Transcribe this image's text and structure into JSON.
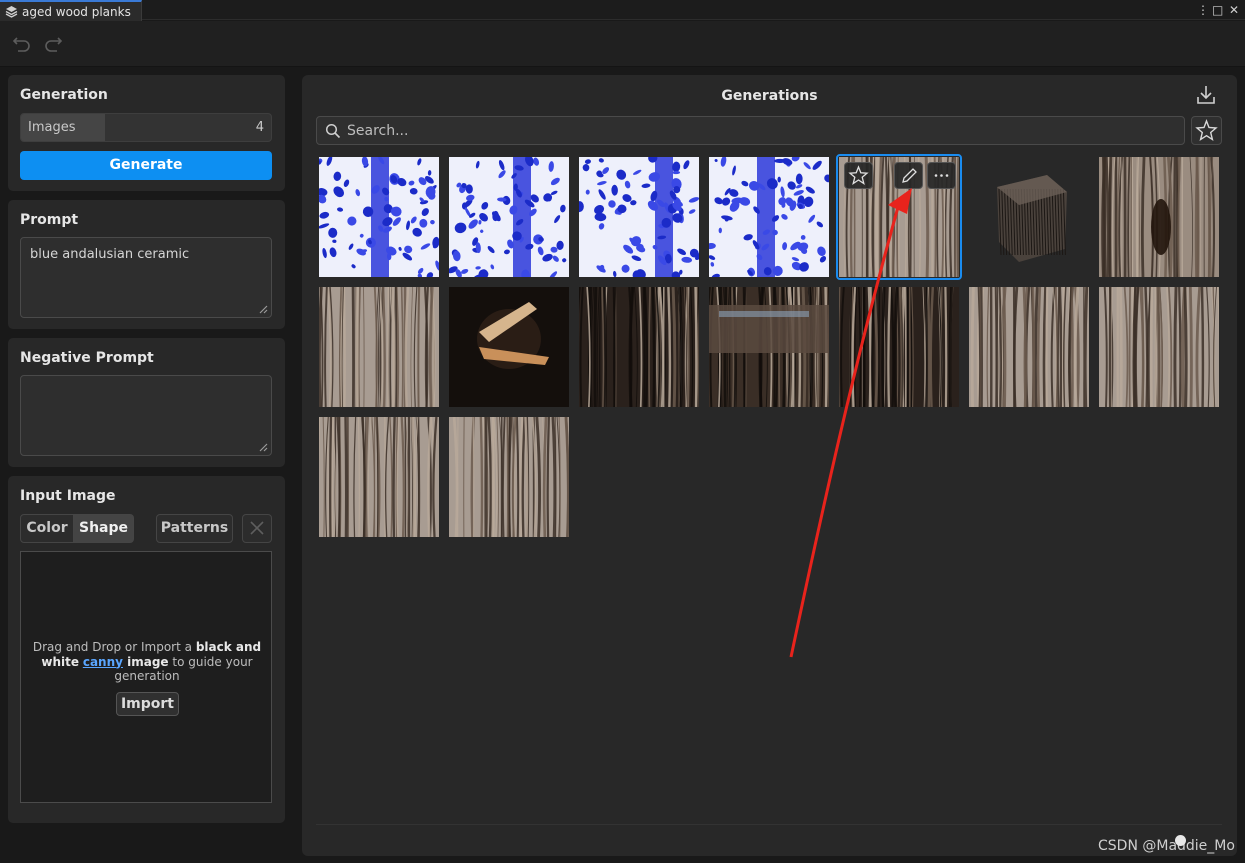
{
  "window": {
    "tab_title": "aged wood planks",
    "menu_glyph": "⋮",
    "maximize_glyph": "□",
    "close_glyph": "✕"
  },
  "generation": {
    "title": "Generation",
    "images_label": "Images",
    "images_value": "4",
    "generate_label": "Generate"
  },
  "prompt": {
    "title": "Prompt",
    "value": "blue andalusian ceramic"
  },
  "negative_prompt": {
    "title": "Negative Prompt",
    "value": ""
  },
  "input_image": {
    "title": "Input Image",
    "tabs": [
      "Color",
      "Shape"
    ],
    "active_tab": "Shape",
    "patterns_label": "Patterns",
    "drop_text_1": "Drag and Drop or Import a ",
    "drop_bold_1": "black and white",
    "drop_link": "canny",
    "drop_bold_2": " image",
    "drop_text_2": " to guide your generation",
    "import_label": "Import"
  },
  "generations": {
    "title": "Generations",
    "search_placeholder": "Search...",
    "items": [
      {
        "kind": "ceramic",
        "variant": 1
      },
      {
        "kind": "ceramic",
        "variant": 2
      },
      {
        "kind": "ceramic",
        "variant": 3
      },
      {
        "kind": "ceramic",
        "variant": 4
      },
      {
        "kind": "wood-light",
        "variant": 1,
        "selected": true
      },
      {
        "kind": "wood-cube",
        "variant": 1
      },
      {
        "kind": "wood-dark-knot",
        "variant": 1
      },
      {
        "kind": "wood-light",
        "variant": 2
      },
      {
        "kind": "wood-splinter",
        "variant": 1
      },
      {
        "kind": "wood-dark",
        "variant": 1
      },
      {
        "kind": "wood-plank",
        "variant": 1
      },
      {
        "kind": "wood-dark",
        "variant": 2
      },
      {
        "kind": "wood-light",
        "variant": 3
      },
      {
        "kind": "wood-light",
        "variant": 4
      },
      {
        "kind": "wood-light",
        "variant": 5
      },
      {
        "kind": "wood-light",
        "variant": 6
      }
    ]
  },
  "watermark": "CSDN @Maddie_Mo",
  "colors": {
    "accent": "#0d8ff2",
    "selection": "#1a8cf0",
    "annotation_arrow": "#e8231c"
  }
}
